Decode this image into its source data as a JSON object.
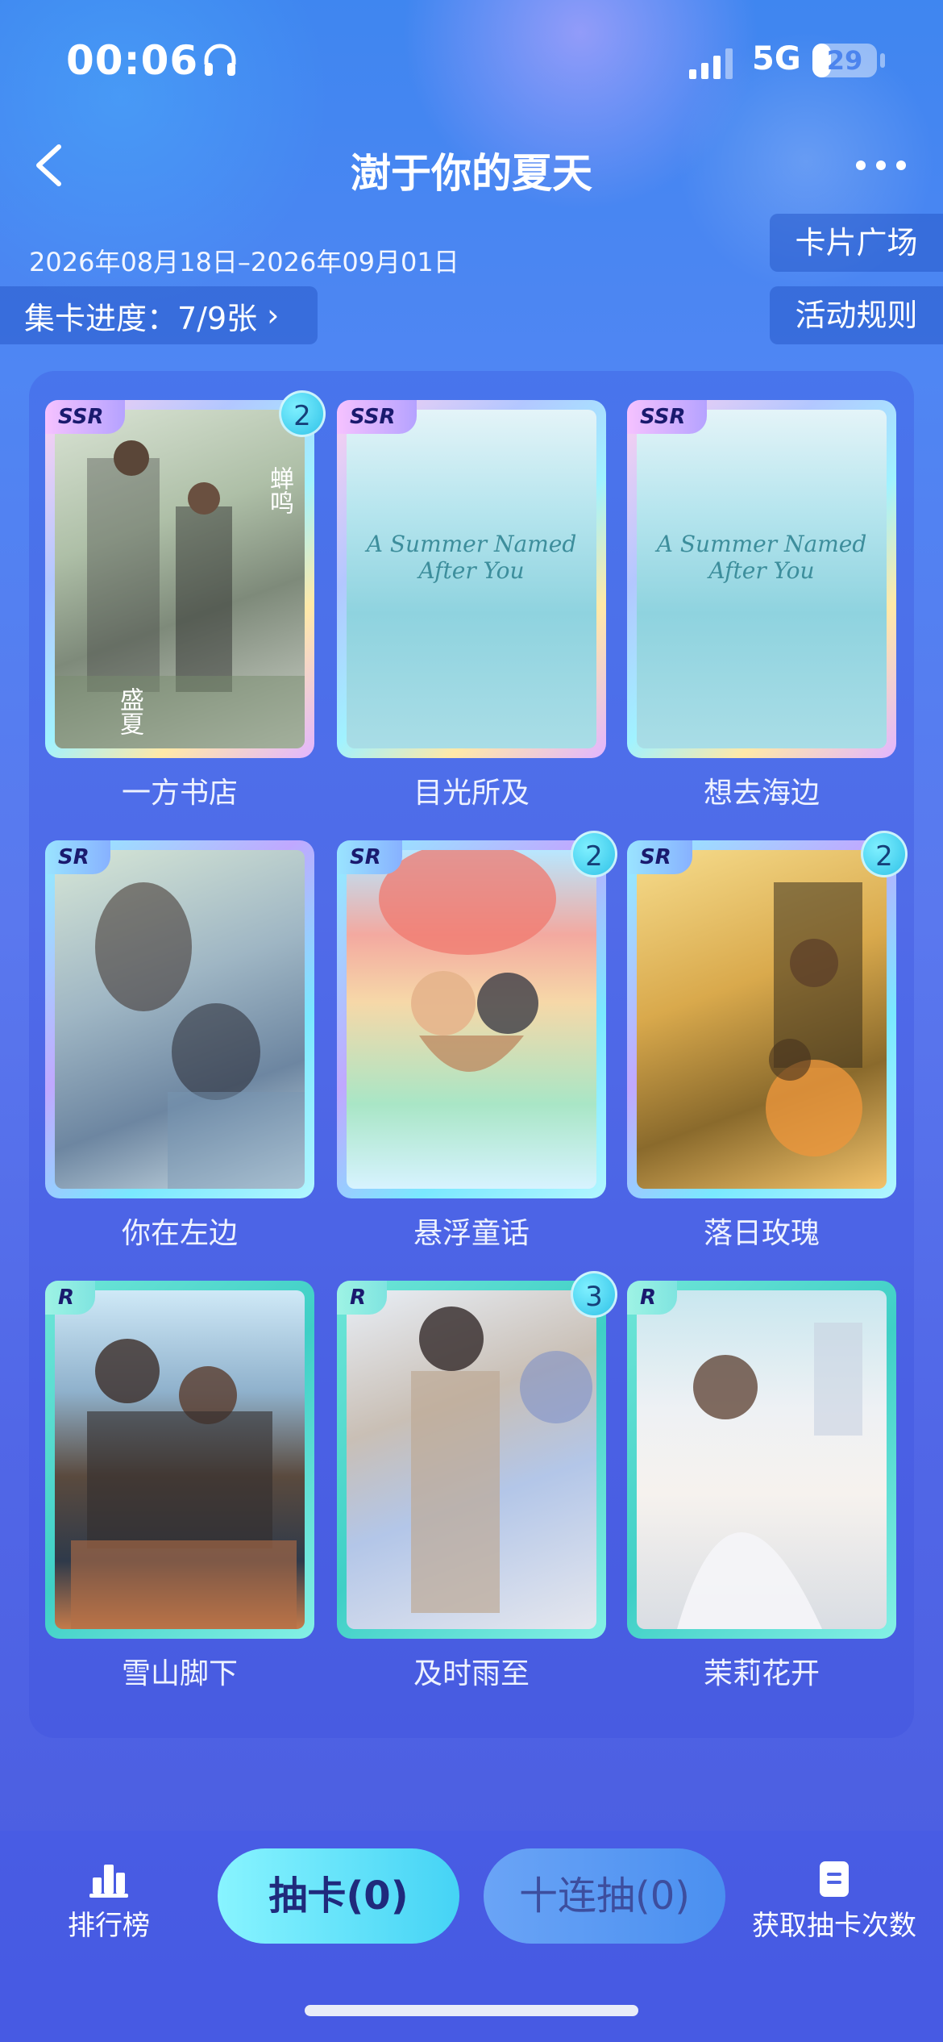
{
  "status_bar": {
    "time": "00:06",
    "network": "5G",
    "battery": "29",
    "battery_fraction": 0.29
  },
  "header": {
    "title": "澍于你的夏天",
    "date_range": "2026年08月18日–2026年09月01日",
    "progress_label": "集卡进度：7/9张",
    "progress_chevron": "›",
    "card_square_label": "卡片广场",
    "rules_label": "活动规则"
  },
  "cards": [
    {
      "name": "一方书店",
      "rarity": "SSR",
      "count": "2"
    },
    {
      "name": "目光所及",
      "rarity": "SSR",
      "count": ""
    },
    {
      "name": "想去海边",
      "rarity": "SSR",
      "count": ""
    },
    {
      "name": "你在左边",
      "rarity": "SR",
      "count": ""
    },
    {
      "name": "悬浮童话",
      "rarity": "SR",
      "count": "2"
    },
    {
      "name": "落日玫瑰",
      "rarity": "SR",
      "count": "2"
    },
    {
      "name": "雪山脚下",
      "rarity": "R",
      "count": ""
    },
    {
      "name": "及时雨至",
      "rarity": "R",
      "count": "3"
    },
    {
      "name": "茉莉花开",
      "rarity": "R",
      "count": ""
    }
  ],
  "card_art_text": {
    "sea_title_line1": "A Summer Named",
    "sea_title_line2": "After You",
    "shop_text": "蝉鸣",
    "shop_text2": "盛夏"
  },
  "bottom_bar": {
    "rank_label": "排行榜",
    "draw_label": "抽卡(0)",
    "ten_draw_label": "十连抽(0)",
    "get_label": "获取抽卡次数"
  },
  "icons": {
    "back": "chevron-left-icon",
    "more": "more-icon",
    "rank": "bar-chart-icon",
    "get": "document-icon",
    "headphone": "headphone-icon",
    "signal": "signal-icon"
  }
}
